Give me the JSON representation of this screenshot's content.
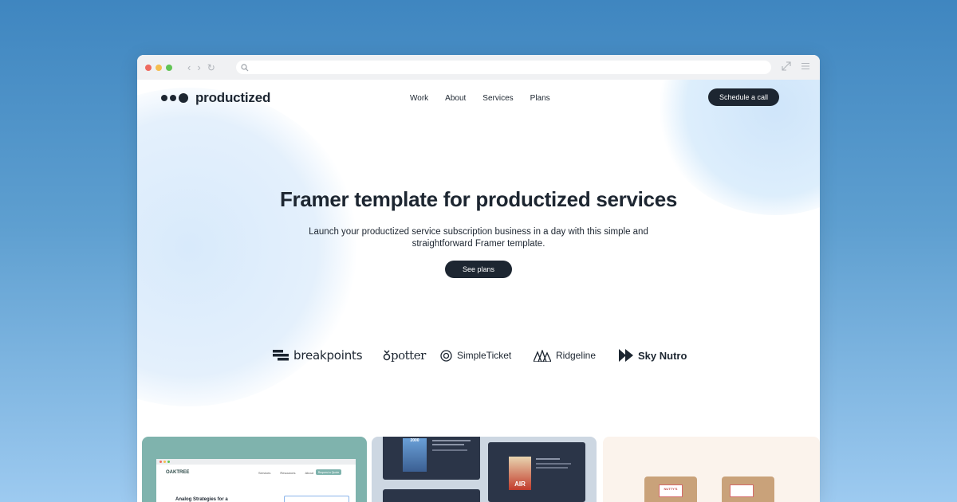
{
  "browser": {
    "dots": [
      "#ee6a5f",
      "#f5bd4f",
      "#61c454"
    ],
    "icons": [
      "back-icon",
      "forward-icon",
      "reload-icon",
      "search-icon",
      "expand-icon",
      "menu-icon"
    ]
  },
  "header": {
    "logo_text": "productized",
    "nav": [
      "Work",
      "About",
      "Services",
      "Plans"
    ],
    "cta_label": "Schedule a call"
  },
  "hero": {
    "title": "Framer template for productized services",
    "subtitle_line1": "Launch your productized service subscription business in a day with this simple and",
    "subtitle_line2": "straightforward Framer template.",
    "button_label": "See plans"
  },
  "clients": [
    {
      "name": "breakpoints",
      "icon": "breakpoints-logo-icon"
    },
    {
      "name": "potter",
      "icon": "potter-logo-icon"
    },
    {
      "name": "SimpleTicket",
      "icon": "simpleticket-logo-icon"
    },
    {
      "name": "Ridgeline",
      "icon": "ridgeline-logo-icon"
    },
    {
      "name": "Sky Nutro",
      "icon": "skynutro-logo-icon"
    }
  ],
  "showcase": {
    "card1": {
      "brand": "OAKTREE",
      "nav": [
        "Services",
        "Resources",
        "About"
      ],
      "button": "Request a Quote",
      "headline": "Analog Strategies for a"
    },
    "card2": {
      "poster_text": "AIR",
      "poster_badge": "2000"
    },
    "card3": {
      "label": "NUTTY'S"
    }
  },
  "colors": {
    "ink": "#1d2631",
    "card1_bg": "#7fb3ad",
    "card2_bg": "#cdd7e2",
    "card3_bg": "#fbf3ec"
  }
}
